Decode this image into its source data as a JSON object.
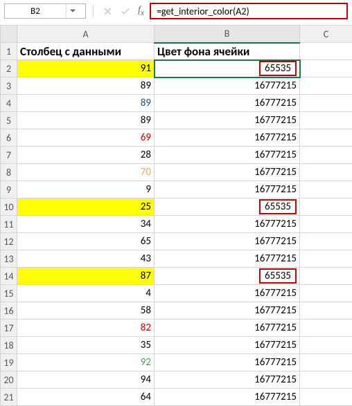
{
  "toolbar": {
    "namebox_value": "B2",
    "formula": "=get_interior_color(A2)"
  },
  "columns": {
    "A": "A",
    "B": "B",
    "C": "C"
  },
  "headers": {
    "A": "Столбец с данными",
    "B": "Цвет фона ячейки"
  },
  "rows": [
    {
      "n": "1"
    },
    {
      "n": "2",
      "a": "91",
      "a_bg": "yellow",
      "b": "65535",
      "b_boxed": true
    },
    {
      "n": "3",
      "a": "89",
      "b": "16777215"
    },
    {
      "n": "4",
      "a": "89",
      "a_cls": "val-blue",
      "b": "16777215"
    },
    {
      "n": "5",
      "a": "89",
      "b": "16777215"
    },
    {
      "n": "6",
      "a": "69",
      "a_cls": "val-red",
      "b": "16777215"
    },
    {
      "n": "7",
      "a": "28",
      "b": "16777215"
    },
    {
      "n": "8",
      "a": "70",
      "a_cls": "val-peach",
      "b": "16777215"
    },
    {
      "n": "9",
      "a": "9",
      "b": "16777215"
    },
    {
      "n": "10",
      "a": "25",
      "a_bg": "yellow",
      "b": "65535",
      "b_boxed": true
    },
    {
      "n": "11",
      "a": "34",
      "b": "16777215"
    },
    {
      "n": "12",
      "a": "65",
      "b": "16777215"
    },
    {
      "n": "13",
      "a": "43",
      "b": "16777215"
    },
    {
      "n": "14",
      "a": "87",
      "a_bg": "yellow",
      "b": "65535",
      "b_boxed": true
    },
    {
      "n": "15",
      "a": "4",
      "b": "16777215"
    },
    {
      "n": "16",
      "a": "58",
      "b": "16777215"
    },
    {
      "n": "17",
      "a": "82",
      "a_cls": "val-red",
      "b": "16777215"
    },
    {
      "n": "18",
      "a": "35",
      "b": "16777215"
    },
    {
      "n": "19",
      "a": "92",
      "a_cls": "val-green",
      "b": "16777215"
    },
    {
      "n": "20",
      "a": "94",
      "b": "16777215"
    },
    {
      "n": "21",
      "a": "64",
      "b": "16777215"
    }
  ],
  "chart_data": {
    "type": "table",
    "title": "Excel sheet showing interior color codes",
    "columns": [
      "Столбец с данными",
      "Цвет фона ячейки"
    ],
    "rows": [
      [
        91,
        65535
      ],
      [
        89,
        16777215
      ],
      [
        89,
        16777215
      ],
      [
        89,
        16777215
      ],
      [
        69,
        16777215
      ],
      [
        28,
        16777215
      ],
      [
        70,
        16777215
      ],
      [
        9,
        16777215
      ],
      [
        25,
        65535
      ],
      [
        34,
        16777215
      ],
      [
        65,
        16777215
      ],
      [
        43,
        16777215
      ],
      [
        87,
        65535
      ],
      [
        4,
        16777215
      ],
      [
        58,
        16777215
      ],
      [
        82,
        16777215
      ],
      [
        35,
        16777215
      ],
      [
        92,
        16777215
      ],
      [
        94,
        16777215
      ],
      [
        64,
        16777215
      ]
    ]
  }
}
